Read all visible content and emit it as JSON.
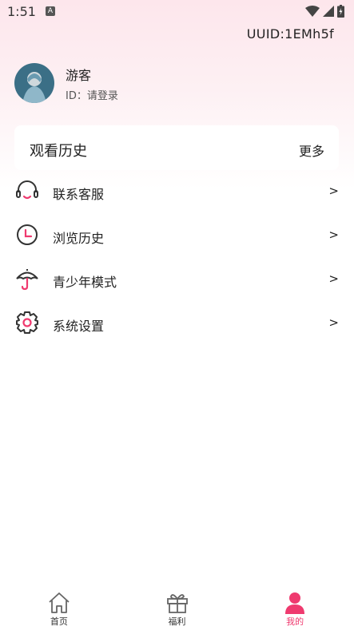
{
  "status_bar": {
    "time": "1:51",
    "notif_badge": "A"
  },
  "header": {
    "uuid": "UUID:1EMh5f"
  },
  "profile": {
    "name": "游客",
    "id_text": "ID：请登录"
  },
  "history": {
    "title": "观看历史",
    "more": "更多"
  },
  "menu": {
    "items": [
      {
        "label": "联系客服",
        "arrow": ">",
        "icon": "headset-icon"
      },
      {
        "label": "浏览历史",
        "arrow": ">",
        "icon": "clock-icon"
      },
      {
        "label": "青少年模式",
        "arrow": ">",
        "icon": "umbrella-icon"
      },
      {
        "label": "系统设置",
        "arrow": ">",
        "icon": "gear-icon"
      }
    ]
  },
  "tabbar": {
    "tabs": [
      {
        "label": "首页",
        "icon": "home-icon"
      },
      {
        "label": "福利",
        "icon": "gift-icon"
      },
      {
        "label": "我的",
        "icon": "user-icon"
      }
    ]
  },
  "colors": {
    "accent": "#ef3a6f",
    "icon_stroke": "#333333"
  }
}
